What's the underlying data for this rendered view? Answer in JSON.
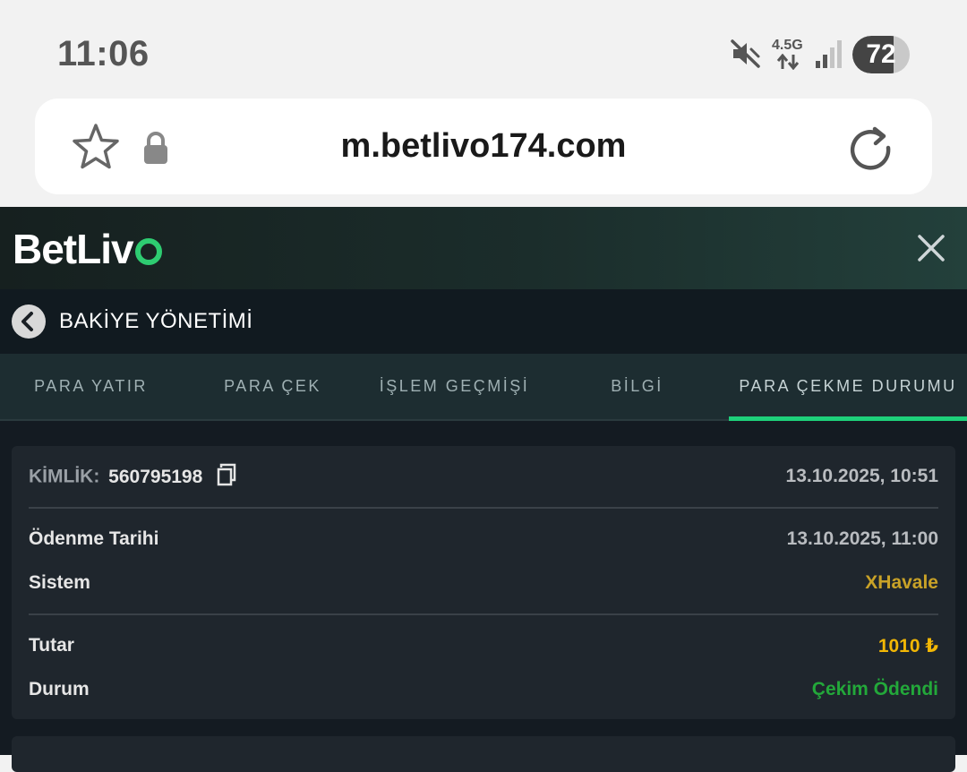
{
  "status_bar": {
    "time": "11:06",
    "network_label": "4.5G",
    "battery": "72",
    "battery_level": 0.72,
    "icons": [
      "mute-icon",
      "data-arrows-icon",
      "signal-icon",
      "battery-icon"
    ]
  },
  "browser": {
    "url": "m.betlivo174.com",
    "icons": [
      "star-icon",
      "lock-icon",
      "reload-icon"
    ]
  },
  "app": {
    "logo_text_main": "BetLiv",
    "brand_color": "#2ecc71",
    "section_title": "BAKİYE YÖNETİMİ",
    "tabs": [
      {
        "label": "PARA YATIR",
        "active": false
      },
      {
        "label": "PARA ÇEK",
        "active": false
      },
      {
        "label": "İŞLEM GEÇMİŞİ",
        "active": false
      },
      {
        "label": "BİLGİ",
        "active": false
      },
      {
        "label": "PARA ÇEKME DURUMU",
        "active": true
      }
    ],
    "accent_color": "#1ed07a"
  },
  "withdrawal": {
    "id_label": "KİMLİK:",
    "id_value": "560795198",
    "created_at": "13.10.2025, 10:51",
    "payment_date_label": "Ödenme Tarihi",
    "payment_date_value": "13.10.2025, 11:00",
    "system_label": "Sistem",
    "system_value": "XHavale",
    "amount_label": "Tutar",
    "amount_value": "1010 ₺",
    "status_label": "Durum",
    "status_value": "Çekim Ödendi",
    "colors": {
      "system": "#c9a227",
      "amount": "#f2b705",
      "status": "#23a83a"
    }
  }
}
